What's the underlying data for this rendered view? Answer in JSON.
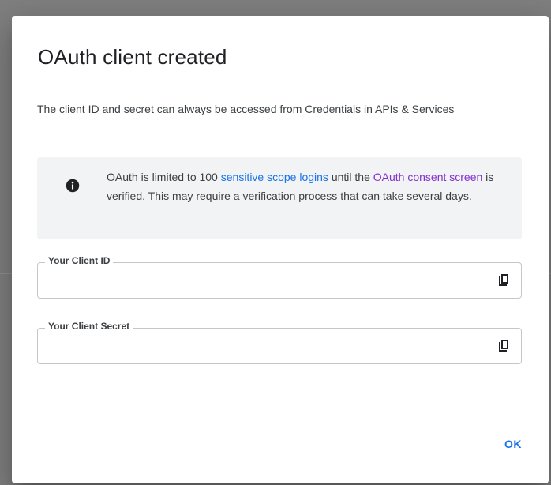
{
  "dialog": {
    "title": "OAuth client created",
    "description": "The client ID and secret can always be accessed from Credentials in APIs & Services",
    "banner": {
      "icon": "info-icon",
      "text_1": "OAuth is limited to 100 ",
      "link_scope": "sensitive scope logins",
      "text_2": " until the ",
      "link_consent": "OAuth consent screen",
      "text_3": " is verified. This may require a verification process that can take several days."
    },
    "client_id": {
      "label": "Your Client ID",
      "value": "",
      "copy_icon": "copy-icon"
    },
    "client_secret": {
      "label": "Your Client Secret",
      "value": "",
      "copy_icon": "copy-icon"
    },
    "ok_label": "OK"
  },
  "colors": {
    "accent": "#1a73e8",
    "visited_link": "#8430ce",
    "banner_bg": "#f1f3f4"
  }
}
